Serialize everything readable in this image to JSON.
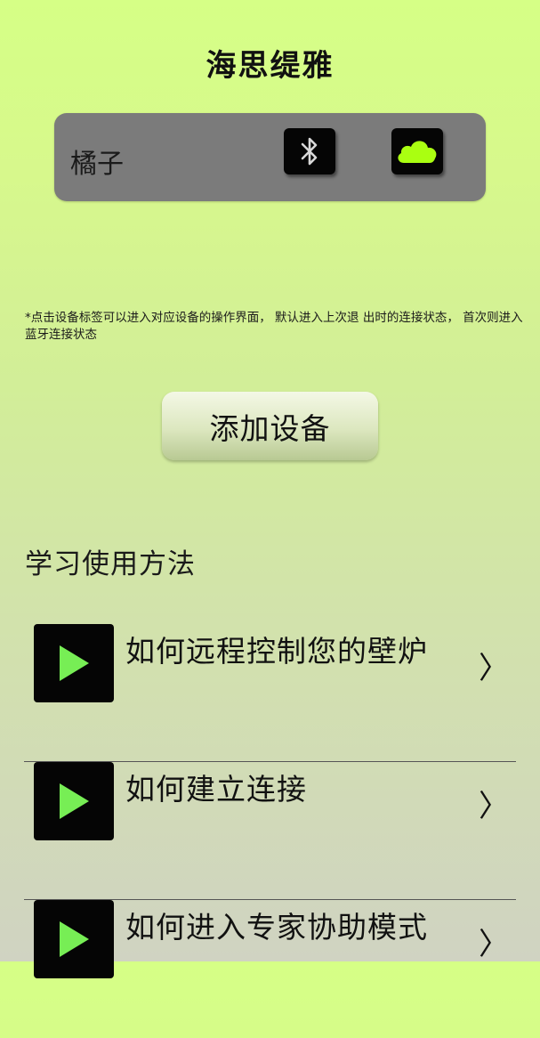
{
  "header": {
    "title": "海思缇雅"
  },
  "device": {
    "name": "橘子",
    "bluetooth_icon": "bluetooth-icon",
    "cloud_icon": "cloud-icon",
    "cloud_color": "#aaff11"
  },
  "hint": {
    "text": "*点击设备标签可以进入对应设备的操作界面， 默认进入上次退 出时的连接状态， 首次则进入蓝牙连接状态"
  },
  "actions": {
    "add_device_label": "添加设备"
  },
  "tutorials": {
    "section_title": "学习使用方法",
    "play_color": "#77ee55",
    "items": [
      {
        "label": "如何远程控制您的壁炉",
        "chevron": "〉"
      },
      {
        "label": "如何建立连接",
        "chevron": "〉"
      },
      {
        "label": "如何进入专家协助模式",
        "chevron": "〉"
      }
    ]
  }
}
